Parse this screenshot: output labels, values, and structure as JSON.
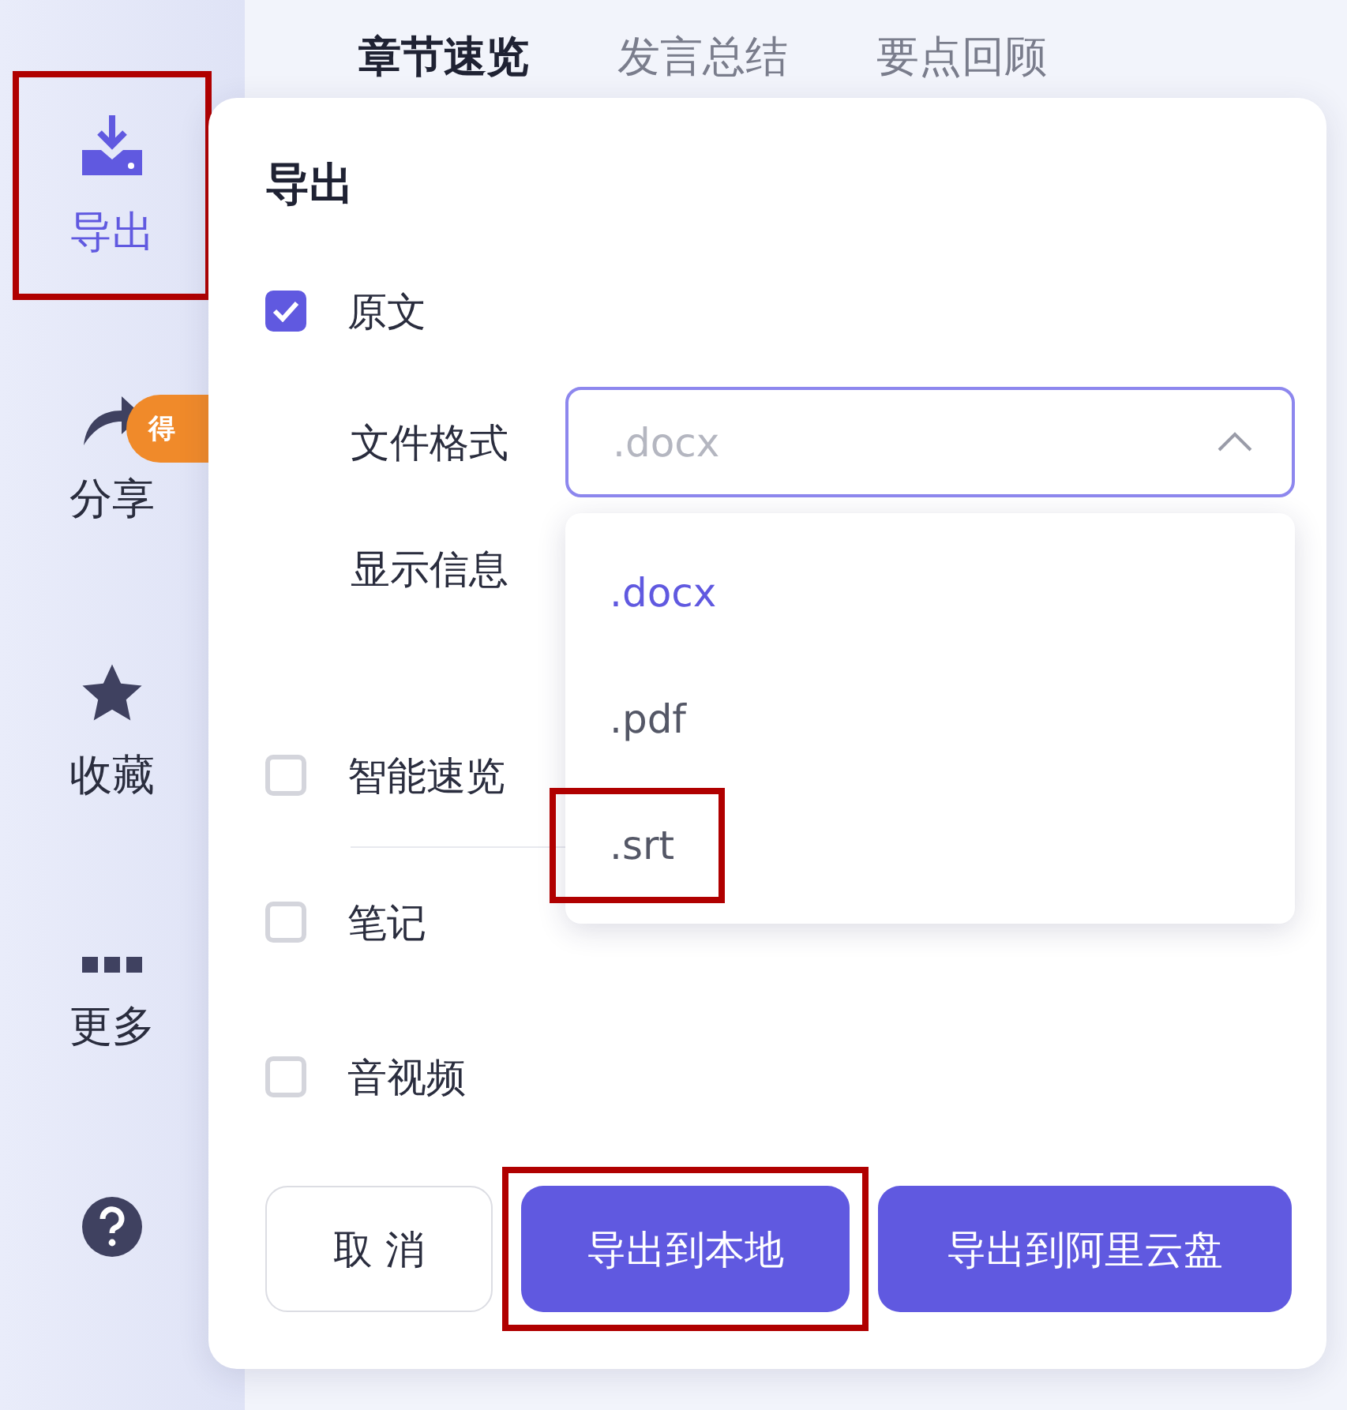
{
  "sidebar": {
    "items": [
      {
        "label": "导出",
        "selected": true,
        "highlighted": true
      },
      {
        "label": "分享",
        "selected": false,
        "highlighted": false,
        "badge": "得"
      },
      {
        "label": "收藏",
        "selected": false,
        "highlighted": false
      },
      {
        "label": "更多",
        "selected": false,
        "highlighted": false
      },
      {
        "selected": false,
        "highlighted": false
      }
    ]
  },
  "tabs": [
    {
      "label": "章节速览",
      "selected": true
    },
    {
      "label": "发言总结",
      "selected": false
    },
    {
      "label": "要点回顾",
      "selected": false
    }
  ],
  "dialog": {
    "title": "导出",
    "options": [
      {
        "label": "原文",
        "checked": true,
        "fields": [
          {
            "label": "文件格式",
            "value": ".docx",
            "expanded": true,
            "menu": [
              {
                "label": ".docx",
                "selected": true,
                "highlighted": false
              },
              {
                "label": ".pdf",
                "selected": false,
                "highlighted": false
              },
              {
                "label": ".srt",
                "selected": false,
                "highlighted": true
              }
            ]
          },
          {
            "label": "显示信息"
          }
        ]
      },
      {
        "label": "智能速览",
        "checked": false
      },
      {
        "label": "笔记",
        "checked": false
      },
      {
        "label": "音视频",
        "checked": false
      }
    ],
    "buttons": [
      {
        "label": "取 消",
        "kind": "secondary",
        "highlighted": false
      },
      {
        "label": "导出到本地",
        "kind": "primary",
        "highlighted": true
      },
      {
        "label": "导出到阿里云盘",
        "kind": "primary",
        "highlighted": false
      }
    ]
  }
}
